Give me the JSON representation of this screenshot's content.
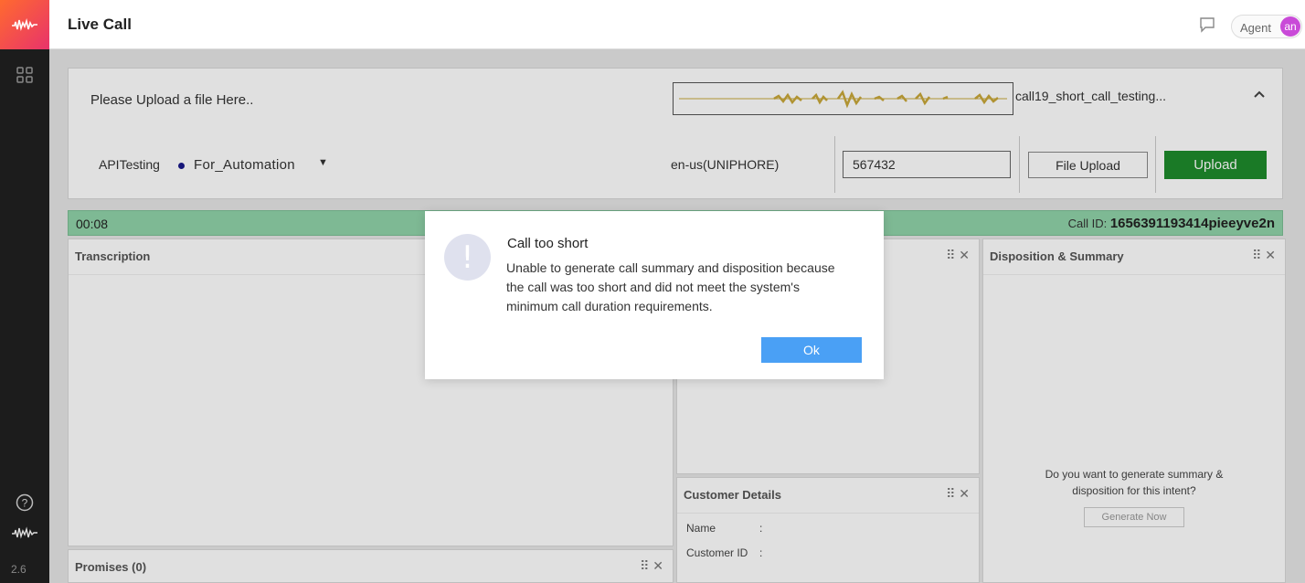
{
  "app": {
    "title": "Live Call",
    "version": "2.6"
  },
  "icons": {
    "brand": "waveform-logo-icon",
    "dashboard": "grid-icon",
    "help": "question-circle-icon",
    "chat": "chat-bubble-icon"
  },
  "colors": {
    "brand_start": "#ff6a2f",
    "brand_end": "#e8336b",
    "upload_button": "#1e8b2c",
    "timer_bar": "#90d3a9",
    "ok_button": "#4aa0f5",
    "avatar": "#c94ad8"
  },
  "header": {
    "agent_label": "Agent",
    "avatar_initials": "an"
  },
  "upload": {
    "hint": "Please Upload a file Here..",
    "file_name": "call19_short_call_testing...",
    "account": "APITesting",
    "campaign": "For_Automation",
    "language": "en-us(UNIPHORE)",
    "id_value": "567432",
    "file_upload_label": "File Upload",
    "upload_label": "Upload"
  },
  "call": {
    "timer": "00:08",
    "id_label": "Call ID:",
    "id_value": "1656391193414pieeyve2n"
  },
  "panels": {
    "transcription": "Transcription",
    "disposition": "Disposition & Summary",
    "customer_details": "Customer Details",
    "promises": "Promises (0)",
    "name_label": "Name",
    "customer_id_label": "Customer ID",
    "colon": ":",
    "generate_question": "Do you want to generate summary & disposition for this intent?",
    "generate_button": "Generate Now"
  },
  "modal": {
    "title": "Call too short",
    "message": "Unable to generate call summary and disposition because the call was too short and did not meet the system's minimum call duration requirements.",
    "ok_label": "Ok"
  }
}
